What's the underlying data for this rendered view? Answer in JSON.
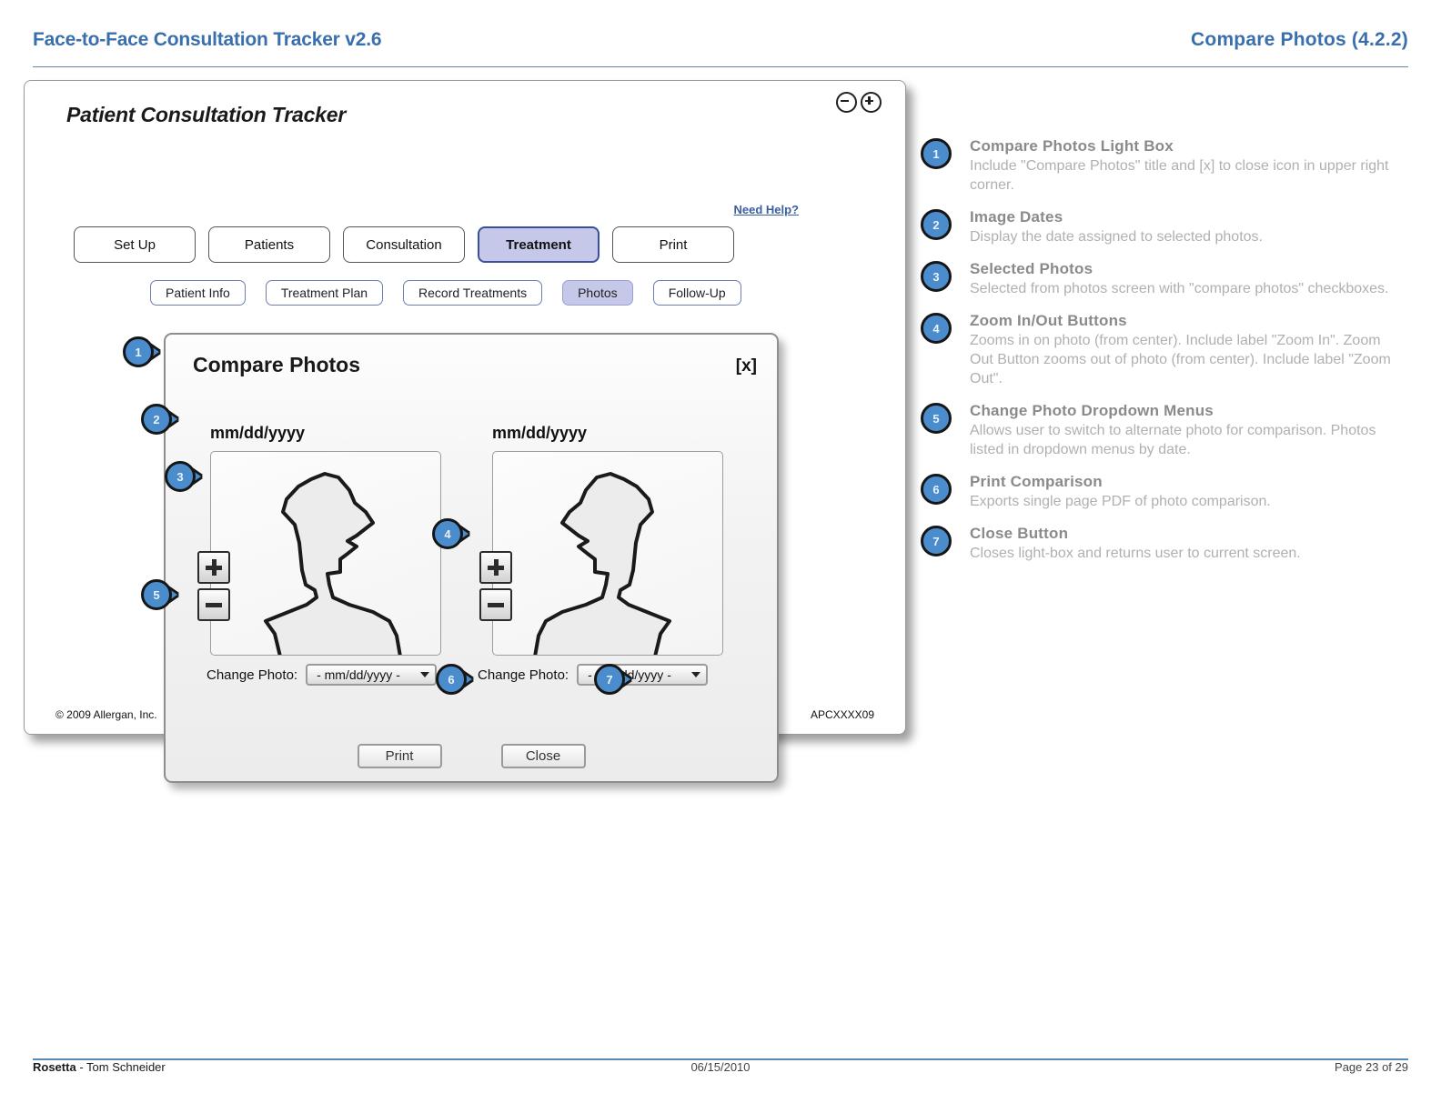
{
  "header": {
    "left_title": "Face-to-Face Consultation Tracker v2.6",
    "right_title": "Compare Photos (4.2.2)",
    "accent_color": "#3a6fad"
  },
  "app": {
    "title": "Patient Consultation Tracker",
    "need_help_label": "Need Help?",
    "window_controls": [
      {
        "icon": "zoom-out-circle-icon"
      },
      {
        "icon": "zoom-in-circle-icon"
      }
    ],
    "primary_tabs": [
      {
        "label": "Set Up",
        "active": false
      },
      {
        "label": "Patients",
        "active": false
      },
      {
        "label": "Consultation",
        "active": false
      },
      {
        "label": "Treatment",
        "active": true
      },
      {
        "label": "Print",
        "active": false
      }
    ],
    "secondary_tabs": [
      {
        "label": "Patient Info",
        "active": false
      },
      {
        "label": "Treatment Plan",
        "active": false
      },
      {
        "label": "Record Treatments",
        "active": false
      },
      {
        "label": "Photos",
        "active": true
      },
      {
        "label": "Follow-Up",
        "active": false
      }
    ],
    "footer_left": "© 2009 Allergan, Inc.",
    "footer_right": "APCXXXX09",
    "active_tab_color": "#c5c8e8"
  },
  "lightbox": {
    "title": "Compare Photos",
    "close_label": "[x]",
    "photos": [
      {
        "date": "mm/dd/yyyy",
        "change_label": "Change Photo:",
        "dropdown_value": "- mm/dd/yyyy -",
        "zoom_in_label": "Zoom In",
        "zoom_out_label": "Zoom Out"
      },
      {
        "date": "mm/dd/yyyy",
        "change_label": "Change Photo:",
        "dropdown_value": "- mm/dd/yyyy -",
        "zoom_in_label": "Zoom In",
        "zoom_out_label": "Zoom Out"
      }
    ],
    "print_label": "Print",
    "close_button_label": "Close"
  },
  "callouts": [
    {
      "number": "1"
    },
    {
      "number": "2"
    },
    {
      "number": "3"
    },
    {
      "number": "4"
    },
    {
      "number": "5"
    },
    {
      "number": "6"
    },
    {
      "number": "7"
    }
  ],
  "annotations": [
    {
      "number": "1",
      "title": "Compare Photos Light Box",
      "description": "Include \"Compare Photos\" title and [x] to close icon in upper right corner."
    },
    {
      "number": "2",
      "title": "Image Dates",
      "description": "Display the date assigned to selected photos."
    },
    {
      "number": "3",
      "title": "Selected Photos",
      "description": "Selected from photos screen with \"compare photos\" checkboxes."
    },
    {
      "number": "4",
      "title": "Zoom In/Out Buttons",
      "description": "Zooms in on photo (from center). Include label \"Zoom In\". Zoom Out Button zooms out of photo (from center). Include label \"Zoom Out\"."
    },
    {
      "number": "5",
      "title": "Change Photo Dropdown Menus",
      "description": "Allows user to switch to alternate photo for comparison. Photos listed in dropdown menus by date."
    },
    {
      "number": "6",
      "title": "Print Comparison",
      "description": "Exports single page PDF of photo comparison."
    },
    {
      "number": "7",
      "title": "Close Button",
      "description": "Closes light-box and returns user to current screen."
    }
  ],
  "page_footer": {
    "author_project": "Rosetta",
    "author_name": "- Tom Schneider",
    "date": "06/15/2010",
    "page": "Page 23 of 29"
  }
}
